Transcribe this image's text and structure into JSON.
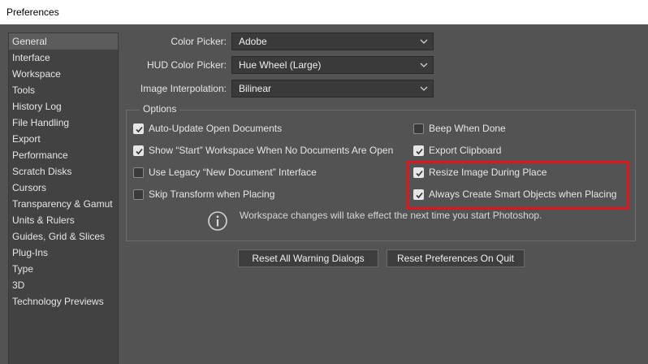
{
  "window": {
    "title": "Preferences"
  },
  "sidebar": {
    "items": [
      {
        "label": "General",
        "selected": true
      },
      {
        "label": "Interface"
      },
      {
        "label": "Workspace"
      },
      {
        "label": "Tools"
      },
      {
        "label": "History Log"
      },
      {
        "label": "File Handling"
      },
      {
        "label": "Export"
      },
      {
        "label": "Performance"
      },
      {
        "label": "Scratch Disks"
      },
      {
        "label": "Cursors"
      },
      {
        "label": "Transparency & Gamut"
      },
      {
        "label": "Units & Rulers"
      },
      {
        "label": "Guides, Grid & Slices"
      },
      {
        "label": "Plug-Ins"
      },
      {
        "label": "Type"
      },
      {
        "label": "3D"
      },
      {
        "label": "Technology Previews"
      }
    ]
  },
  "general": {
    "color_picker": {
      "label": "Color Picker:",
      "value": "Adobe"
    },
    "hud_color_picker": {
      "label": "HUD Color Picker:",
      "value": "Hue Wheel (Large)"
    },
    "image_interpolation": {
      "label": "Image Interpolation:",
      "value": "Bilinear"
    }
  },
  "options": {
    "legend": "Options",
    "left": [
      {
        "label": "Auto-Update Open Documents",
        "checked": true
      },
      {
        "label": "Show “Start” Workspace When No Documents Are Open",
        "checked": true
      },
      {
        "label": "Use Legacy “New Document” Interface",
        "checked": false
      },
      {
        "label": "Skip Transform when Placing",
        "checked": false
      }
    ],
    "right": [
      {
        "label": "Beep When Done",
        "checked": false
      },
      {
        "label": "Export Clipboard",
        "checked": true
      },
      {
        "label": "Resize Image During Place",
        "checked": true
      },
      {
        "label": "Always Create Smart Objects when Placing",
        "checked": true
      }
    ],
    "info_text": "Workspace changes will take effect the next time you start Photoshop."
  },
  "buttons": {
    "reset_warnings": "Reset All Warning Dialogs",
    "reset_prefs": "Reset Preferences On Quit"
  },
  "colors": {
    "highlight": "#e0141c"
  }
}
